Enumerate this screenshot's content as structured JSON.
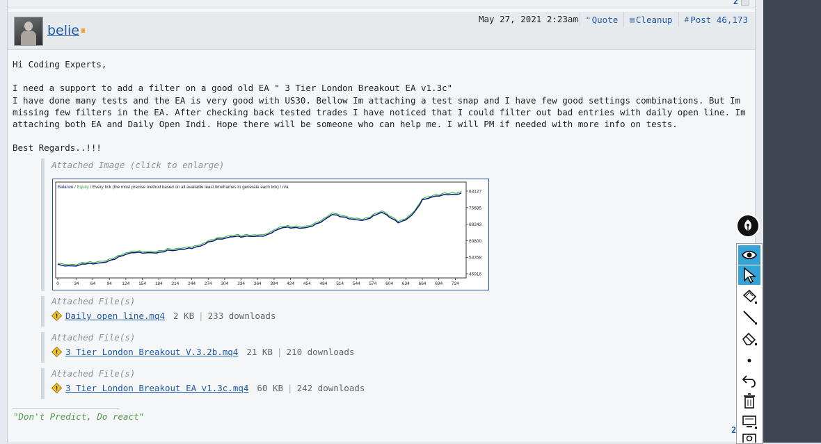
{
  "top_strip": {
    "page_number": "2"
  },
  "post": {
    "username": "belie",
    "date": "May 27, 2021 2:23am",
    "actions": [
      {
        "icon": "quote-icon",
        "label": "Quote"
      },
      {
        "icon": "cleanup-icon",
        "label": "Cleanup"
      },
      {
        "icon": "hash-icon",
        "label": "Post 46,173"
      }
    ],
    "body": {
      "greeting": "Hi Coding Experts,",
      "line1": "I need a support to add a filter on a good old EA \" 3 Tier London Breakout EA v1.3c\"",
      "paragraph": "I have done many tests and the EA is very good with US30. Bellow Im attaching a test snap and I have few good settings combinations. But Im missing few filters in the EA. After checking back tested trades I have noticed that I could filter out bad entries with daily open line. Im attaching both EA and Daily Open Indi. Hope there will be someone who can help me. I will PM if needed with more info on tests.",
      "closing": "Best Regards..!!!"
    },
    "attached_image_title": "Attached Image (click to enlarge)",
    "attachments": [
      {
        "title": "Attached File(s)",
        "file": "Daily open line.mq4",
        "size": "2 KB",
        "downloads": "233 downloads"
      },
      {
        "title": "Attached File(s)",
        "file": "3 Tier London Breakout V.3.2b.mq4",
        "size": "21 KB",
        "downloads": "210 downloads"
      },
      {
        "title": "Attached File(s)",
        "file": "3 Tier London Breakout EA v1.3c.mq4",
        "size": "60 KB",
        "downloads": "242 downloads"
      }
    ],
    "signature": "\"Don't Predict, Do react\""
  },
  "bottom": {
    "page_number": "2"
  },
  "chart_data": {
    "type": "line",
    "legend_balance": "Balance",
    "legend_slash": " / ",
    "legend_equity": "Equity",
    "subtitle": " / Every tick (the most precise method based on all available least timeframes to generate each tick) / n/a",
    "x_ticks": [
      "0",
      "34",
      "64",
      "94",
      "124",
      "154",
      "184",
      "214",
      "244",
      "274",
      "304",
      "334",
      "364",
      "394",
      "424",
      "454",
      "484",
      "514",
      "544",
      "574",
      "604",
      "634",
      "664",
      "694",
      "724"
    ],
    "y_ticks": [
      "83127",
      "75685",
      "68243",
      "60800",
      "53358",
      "45916"
    ],
    "ylim": [
      45916,
      83127
    ],
    "xlim": [
      0,
      740
    ],
    "series": [
      {
        "name": "Balance",
        "color": "#0a1a7a",
        "x": [
          0,
          20,
          34,
          50,
          64,
          80,
          94,
          110,
          124,
          140,
          154,
          170,
          184,
          200,
          214,
          230,
          244,
          260,
          274,
          290,
          304,
          320,
          334,
          350,
          364,
          380,
          394,
          410,
          424,
          440,
          454,
          470,
          484,
          500,
          514,
          530,
          544,
          560,
          574,
          590,
          604,
          620,
          634,
          650,
          664,
          680,
          694,
          710,
          724,
          735
        ],
        "y": [
          50200,
          49000,
          48800,
          50200,
          50800,
          51500,
          52000,
          53000,
          54000,
          55200,
          55600,
          56000,
          55800,
          56200,
          55800,
          56600,
          57600,
          59000,
          60600,
          61300,
          61200,
          62200,
          62600,
          63400,
          63300,
          63200,
          64500,
          66200,
          66600,
          67000,
          67300,
          68300,
          69400,
          72000,
          71600,
          71200,
          70800,
          70300,
          71400,
          73000,
          71200,
          69300,
          70800,
          74000,
          78800,
          79700,
          80600,
          81800,
          82200,
          82600
        ]
      },
      {
        "name": "Equity",
        "color": "#3cb043"
      }
    ]
  },
  "toolbar": {
    "tools": [
      "eye-icon",
      "cursor-icon",
      "highlighter-icon",
      "line-icon",
      "eraser-icon",
      "dot-icon",
      "undo-icon",
      "trash-icon",
      "screen-icon"
    ]
  }
}
